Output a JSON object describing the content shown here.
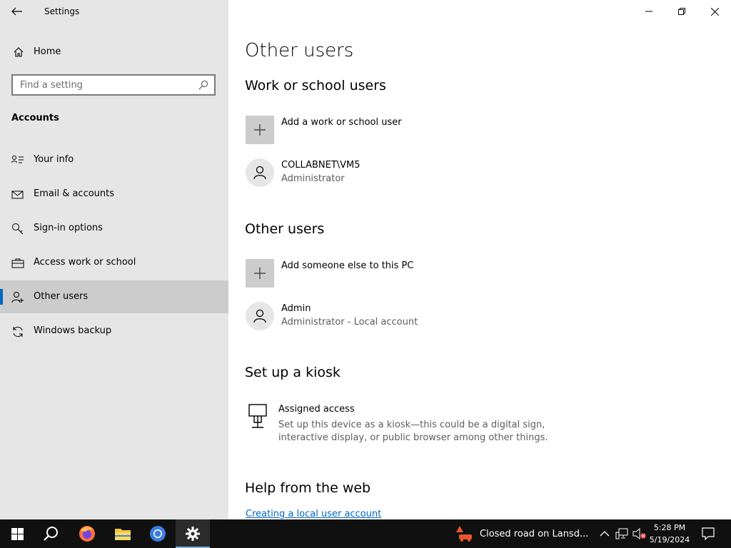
{
  "window": {
    "title": "Settings"
  },
  "sidebar": {
    "home_label": "Home",
    "search_placeholder": "Find a setting",
    "section": "Accounts",
    "items": [
      {
        "label": "Your info",
        "icon": "person-card-icon"
      },
      {
        "label": "Email & accounts",
        "icon": "mail-icon"
      },
      {
        "label": "Sign-in options",
        "icon": "key-icon"
      },
      {
        "label": "Access work or school",
        "icon": "briefcase-icon"
      },
      {
        "label": "Other users",
        "icon": "person-add-icon",
        "selected": true
      },
      {
        "label": "Windows backup",
        "icon": "sync-icon"
      }
    ]
  },
  "main": {
    "title": "Other users",
    "work_school": {
      "heading": "Work or school users",
      "add_label": "Add a work or school user",
      "user": {
        "name": "COLLABNET\\VM5",
        "role": "Administrator"
      }
    },
    "other_users": {
      "heading": "Other users",
      "add_label": "Add someone else to this PC",
      "user": {
        "name": "Admin",
        "role": "Administrator - Local account"
      }
    },
    "kiosk": {
      "heading": "Set up a kiosk",
      "title": "Assigned access",
      "description": "Set up this device as a kiosk—this could be a digital sign, interactive display, or public browser among other things."
    },
    "help": {
      "heading": "Help from the web",
      "link": "Creating a local user account"
    }
  },
  "taskbar": {
    "news": "Closed road on Lansd...",
    "time": "5:28 PM",
    "date": "5/19/2024",
    "accent": "#0067c0"
  }
}
